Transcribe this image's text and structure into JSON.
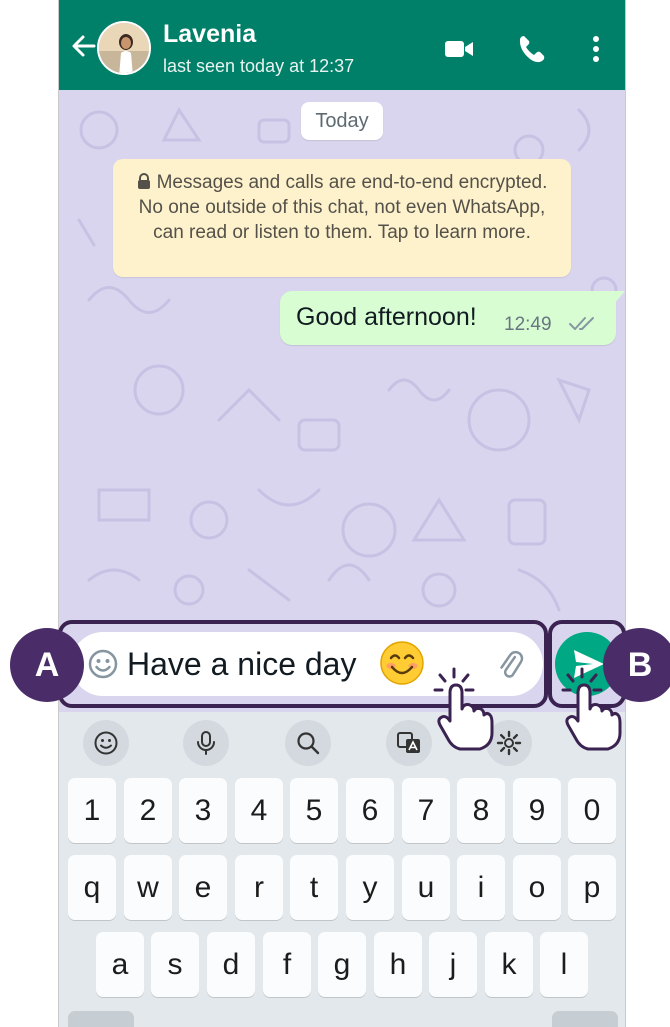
{
  "header": {
    "contact_name": "Lavenia",
    "status": "last seen today at 12:37"
  },
  "chat": {
    "date_chip": "Today",
    "encryption_notice": "Messages and calls are end-to-end encrypted. No one outside of this chat, not even WhatsApp, can read or listen to them. Tap to learn more.",
    "messages": [
      {
        "text": "Good afternoon!",
        "time": "12:49",
        "direction": "outgoing",
        "status": "read"
      }
    ]
  },
  "composer": {
    "text": "Have a nice day"
  },
  "keyboard": {
    "row_numbers": [
      "1",
      "2",
      "3",
      "4",
      "5",
      "6",
      "7",
      "8",
      "9",
      "0"
    ],
    "row_top": [
      "q",
      "w",
      "e",
      "r",
      "t",
      "y",
      "u",
      "i",
      "o",
      "p"
    ],
    "row_middle": [
      "a",
      "s",
      "d",
      "f",
      "g",
      "h",
      "j",
      "k",
      "l"
    ]
  },
  "annotations": {
    "label_a": "A",
    "label_b": "B"
  },
  "colors": {
    "header": "#008069",
    "send_button": "#00a884",
    "outgoing_bubble": "#d9fdd3",
    "system_notice": "#fef2cc",
    "chat_background": "#d9d5ee",
    "annotation": "#4a2d68"
  }
}
